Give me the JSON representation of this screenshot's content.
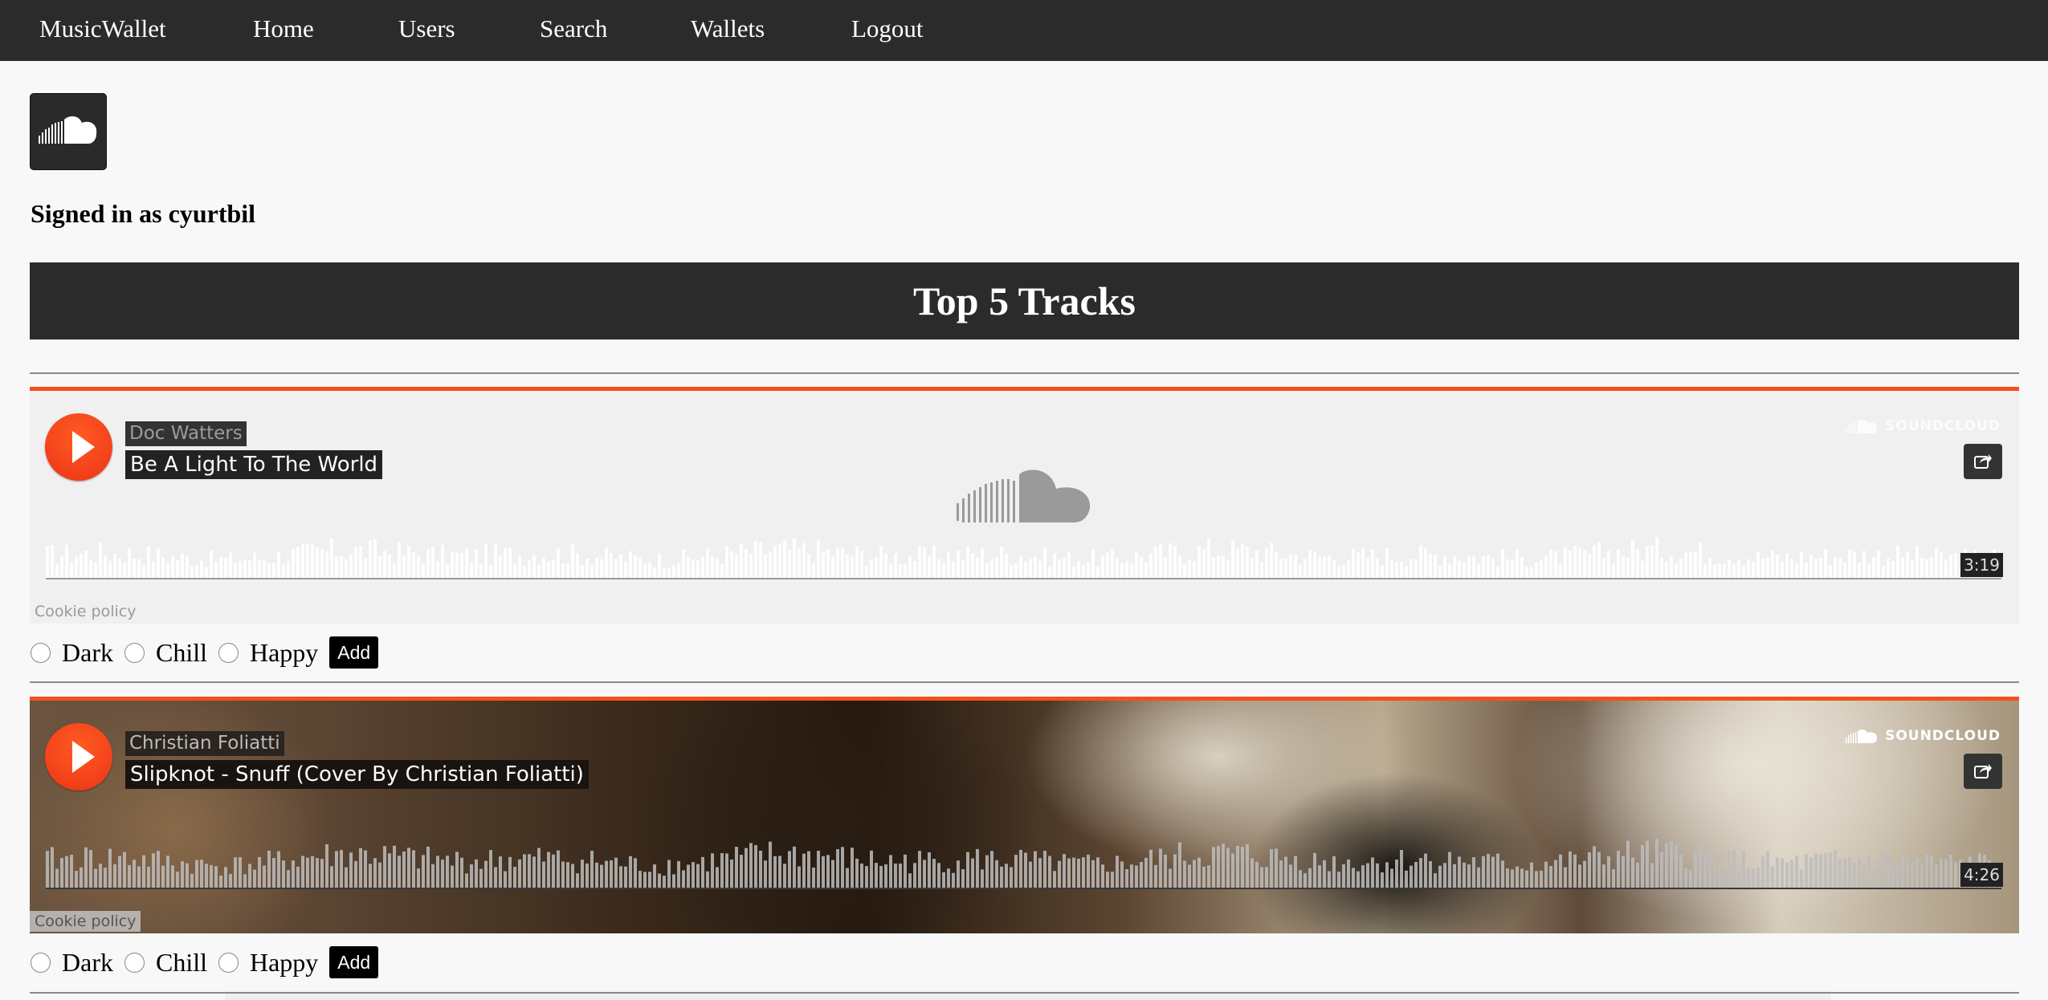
{
  "nav": {
    "brand": "MusicWallet",
    "items": [
      "Home",
      "Users",
      "Search",
      "Wallets",
      "Logout"
    ]
  },
  "service_icon": "soundcloud-icon",
  "signed_in": "Signed in as cyurtbil",
  "header": "Top 5 Tracks",
  "brand_text": "SOUNDCLOUD",
  "moods": [
    "Dark",
    "Chill",
    "Happy"
  ],
  "add_label": "Add",
  "cookie_label": "Cookie policy",
  "colors": {
    "nav_bg": "#2b2b2b",
    "accent": "#f2521a",
    "play": "#f2401a"
  },
  "tracks": [
    {
      "artist": "Doc Watters",
      "title": "Be A Light To The World",
      "duration": "3:19"
    },
    {
      "artist": "Christian Foliatti",
      "title": "Slipknot - Snuff (Cover By Christian Foliatti)",
      "duration": "4:26"
    }
  ]
}
